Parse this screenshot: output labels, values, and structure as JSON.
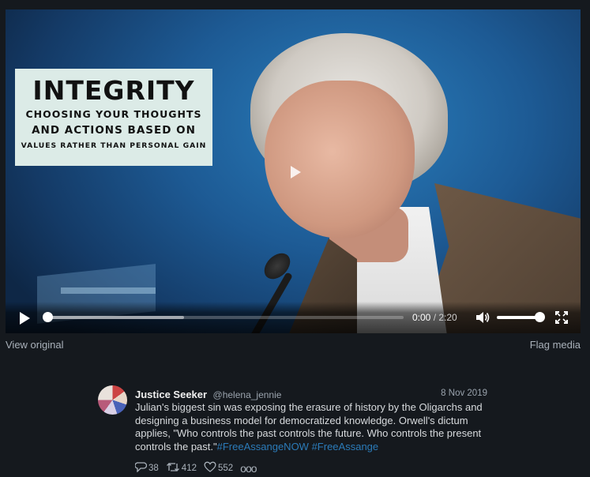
{
  "media": {
    "quote_card": {
      "title": "INTEGRITY",
      "line1": "CHOOSING YOUR THOUGHTS",
      "line2": "AND ACTIONS BASED ON",
      "line3": "VALUES RATHER THAN PERSONAL GAIN"
    },
    "controls": {
      "current_time": "0:00",
      "separator": " / ",
      "duration": "2:20",
      "progress_fraction": 0.0,
      "buffered_fraction": 0.39,
      "volume_fraction": 1.0
    },
    "icons": [
      "play-icon",
      "volume-icon",
      "fullscreen-icon"
    ]
  },
  "links": {
    "view_original": "View original",
    "flag_media": "Flag media"
  },
  "tweet": {
    "author_name": "Justice Seeker",
    "author_handle": "@helena_jennie",
    "date": "8 Nov 2019",
    "text": "Julian's biggest sin was exposing the erasure of history by the Oligarchs and designing a business model for democratized knowledge. Orwell's dictum applies, \"Who controls the past controls the future. Who controls the present controls the past.\"",
    "hashtag1": "#FreeAssangeNOW",
    "hashtag2": "#FreeAssange",
    "replies": "38",
    "retweets": "412",
    "likes": "552",
    "more": "ooo"
  },
  "colors": {
    "background": "#15191e",
    "hashtag": "#2b7bb9",
    "secondary_text": "#9aa3ad"
  }
}
